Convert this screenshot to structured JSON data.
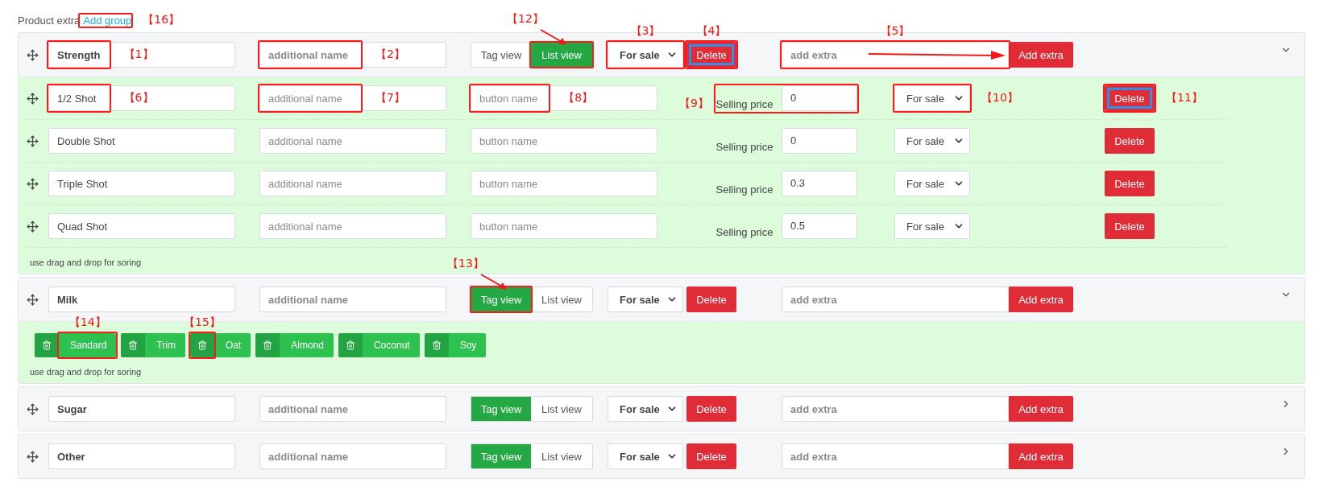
{
  "header": {
    "title": "Product extra",
    "link": {
      "label": "Add group",
      "callout": "【16】"
    }
  },
  "groups": [
    {
      "name": {
        "value": "Strength",
        "callout": "【1】"
      },
      "additional": {
        "placeholder": "additional name",
        "callout": "【2】"
      },
      "views": [
        {
          "label": "Tag view",
          "selected": false
        },
        {
          "label": "List view",
          "selected": true,
          "callout": "【12】"
        }
      ],
      "status": {
        "value": "For sale",
        "callout": "【3】"
      },
      "delete": {
        "label": "Delete",
        "focused": true,
        "callout": "【4】"
      },
      "extra": {
        "placeholder": "add extra",
        "callout": "【5】"
      },
      "add_button": "Add extra",
      "expanded": true,
      "items": [
        {
          "name": {
            "value": "1/2 Shot",
            "callout": "【6】"
          },
          "additional": {
            "placeholder": "additional name",
            "callout": "【7】"
          },
          "button": {
            "placeholder": "button name",
            "callout": "【8】"
          },
          "price_label": "Selling price",
          "price": {
            "value": "0",
            "callout": "【9】"
          },
          "status": {
            "value": "For sale",
            "callout": "【10】"
          },
          "delete": {
            "label": "Delete",
            "focused": true,
            "callout": "【11】"
          }
        },
        {
          "name": {
            "value": "Double Shot"
          },
          "additional": {
            "placeholder": "additional name"
          },
          "button": {
            "placeholder": "button name"
          },
          "price_label": "Selling price",
          "price": {
            "value": "0"
          },
          "status": {
            "value": "For sale"
          },
          "delete": {
            "label": "Delete",
            "focused": false
          }
        },
        {
          "name": {
            "value": "Triple Shot"
          },
          "additional": {
            "placeholder": "additional name"
          },
          "button": {
            "placeholder": "button name"
          },
          "price_label": "Selling price",
          "price": {
            "value": "0.3"
          },
          "status": {
            "value": "For sale"
          },
          "delete": {
            "label": "Delete",
            "focused": false
          }
        },
        {
          "name": {
            "value": "Quad Shot"
          },
          "additional": {
            "placeholder": "additional name"
          },
          "button": {
            "placeholder": "button name"
          },
          "price_label": "Selling price",
          "price": {
            "value": "0.5"
          },
          "status": {
            "value": "For sale"
          },
          "delete": {
            "label": "Delete",
            "focused": false
          }
        }
      ],
      "footer": "use drag and drop for soring"
    },
    {
      "name": {
        "value": "Milk"
      },
      "additional": {
        "placeholder": "additional name"
      },
      "views": [
        {
          "label": "Tag view",
          "selected": true,
          "callout": "【13】"
        },
        {
          "label": "List view",
          "selected": false
        }
      ],
      "status": {
        "value": "For sale"
      },
      "delete": {
        "label": "Delete",
        "focused": false
      },
      "extra": {
        "placeholder": "add extra"
      },
      "add_button": "Add extra",
      "expanded": true,
      "tags": [
        {
          "label": "Sandard",
          "callout": "【14】"
        },
        {
          "label": "Trim"
        },
        {
          "label": "Oat",
          "icon_callout": "【15】"
        },
        {
          "label": "Almond"
        },
        {
          "label": "Coconut"
        },
        {
          "label": "Soy"
        }
      ],
      "footer": "use drag and drop for soring"
    },
    {
      "name": {
        "value": "Sugar"
      },
      "additional": {
        "placeholder": "additional name"
      },
      "views": [
        {
          "label": "Tag view",
          "selected": true
        },
        {
          "label": "List view",
          "selected": false
        }
      ],
      "status": {
        "value": "For sale"
      },
      "delete": {
        "label": "Delete",
        "focused": false
      },
      "extra": {
        "placeholder": "add extra"
      },
      "add_button": "Add extra",
      "expanded": false
    },
    {
      "name": {
        "value": "Other"
      },
      "additional": {
        "placeholder": "additional name"
      },
      "views": [
        {
          "label": "Tag view",
          "selected": true
        },
        {
          "label": "List view",
          "selected": false
        }
      ],
      "status": {
        "value": "For sale"
      },
      "delete": {
        "label": "Delete",
        "focused": false
      },
      "extra": {
        "placeholder": "add extra"
      },
      "add_button": "Add extra",
      "expanded": false
    }
  ]
}
